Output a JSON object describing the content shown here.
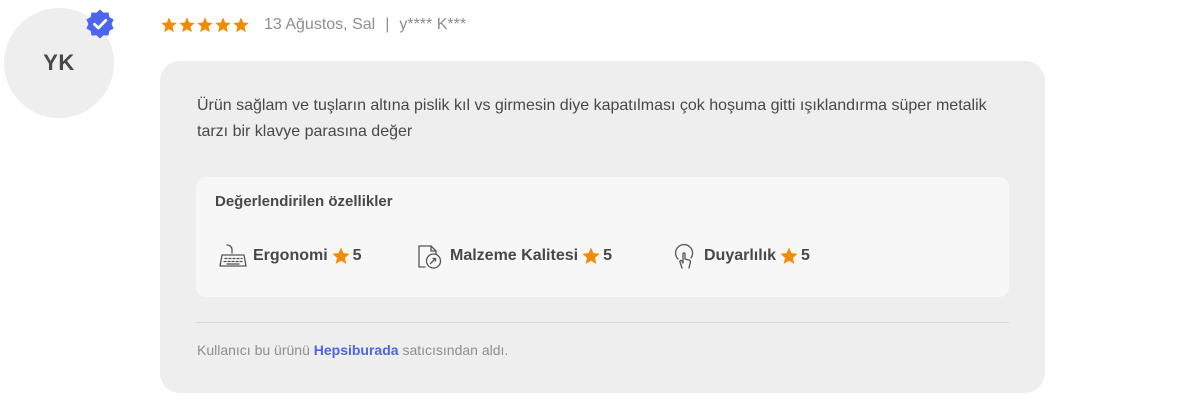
{
  "reviewer": {
    "initials": "YK",
    "masked_name": "y**** K***",
    "verified": true
  },
  "review": {
    "rating": 5,
    "date": "13 Ağustos, Sal",
    "separator": "|",
    "text": "Ürün sağlam ve tuşların altına pislik kıl vs girmesin diye kapatılması çok hoşuma gitti ışıklandırma süper metalik tarzı bir klavye parasına değer"
  },
  "features": {
    "title": "Değerlendirilen özellikler",
    "items": [
      {
        "icon": "keyboard-icon",
        "label": "Ergonomi",
        "score": "5"
      },
      {
        "icon": "material-quality-icon",
        "label": "Malzeme Kalitesi",
        "score": "5"
      },
      {
        "icon": "touch-response-icon",
        "label": "Duyarlılık",
        "score": "5"
      }
    ]
  },
  "seller": {
    "prefix": "Kullanıcı bu ürünü",
    "name": "Hepsiburada",
    "suffix": "satıcısından aldı."
  },
  "colors": {
    "star": "#f28b00",
    "badge": "#4d64ec",
    "card_bg": "#eeeeee",
    "features_bg": "#f7f7f7",
    "link": "#4d64ec"
  }
}
